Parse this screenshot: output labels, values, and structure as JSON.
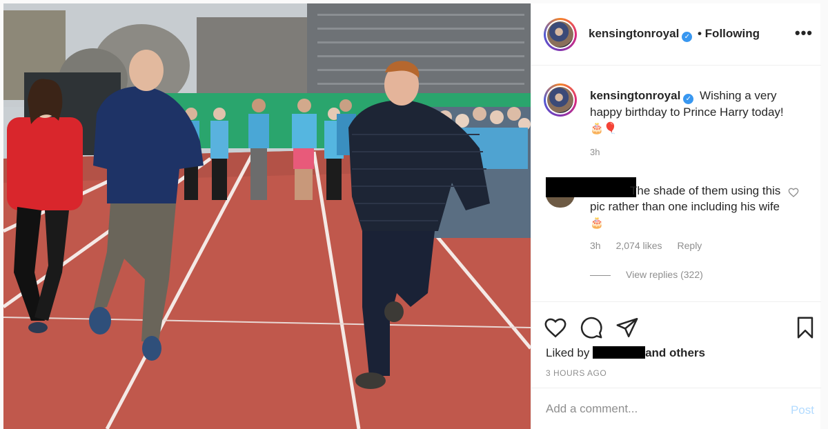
{
  "post": {
    "username": "kensingtonroyal",
    "verified_icon": "verified-badge-icon",
    "follow_status": "• Following",
    "more_icon": "more-options-icon",
    "more_label": "•••"
  },
  "caption": {
    "username": "kensingtonroyal",
    "text": "Wishing a very happy birthday to Prince Harry today!",
    "emojis": "🎂🎈",
    "time": "3h"
  },
  "comment": {
    "text": "The shade of them using this pic rather than one including his wife",
    "emoji": "🎂",
    "time": "3h",
    "likes": "2,074 likes",
    "reply": "Reply",
    "view_replies": "View replies (322)",
    "like_icon": "heart-outline-icon"
  },
  "actions": {
    "icons": [
      "heart-icon",
      "comment-icon",
      "share-icon",
      "bookmark-icon"
    ],
    "liked_prefix": "Liked by",
    "liked_suffix": "and others",
    "post_time": "3 HOURS AGO"
  },
  "add_comment": {
    "placeholder": "Add a comment...",
    "post_label": "Post"
  },
  "colors": {
    "accent": "#3897f0",
    "post_disabled": "#b3dbff",
    "secondary_text": "#8e8e8e"
  }
}
